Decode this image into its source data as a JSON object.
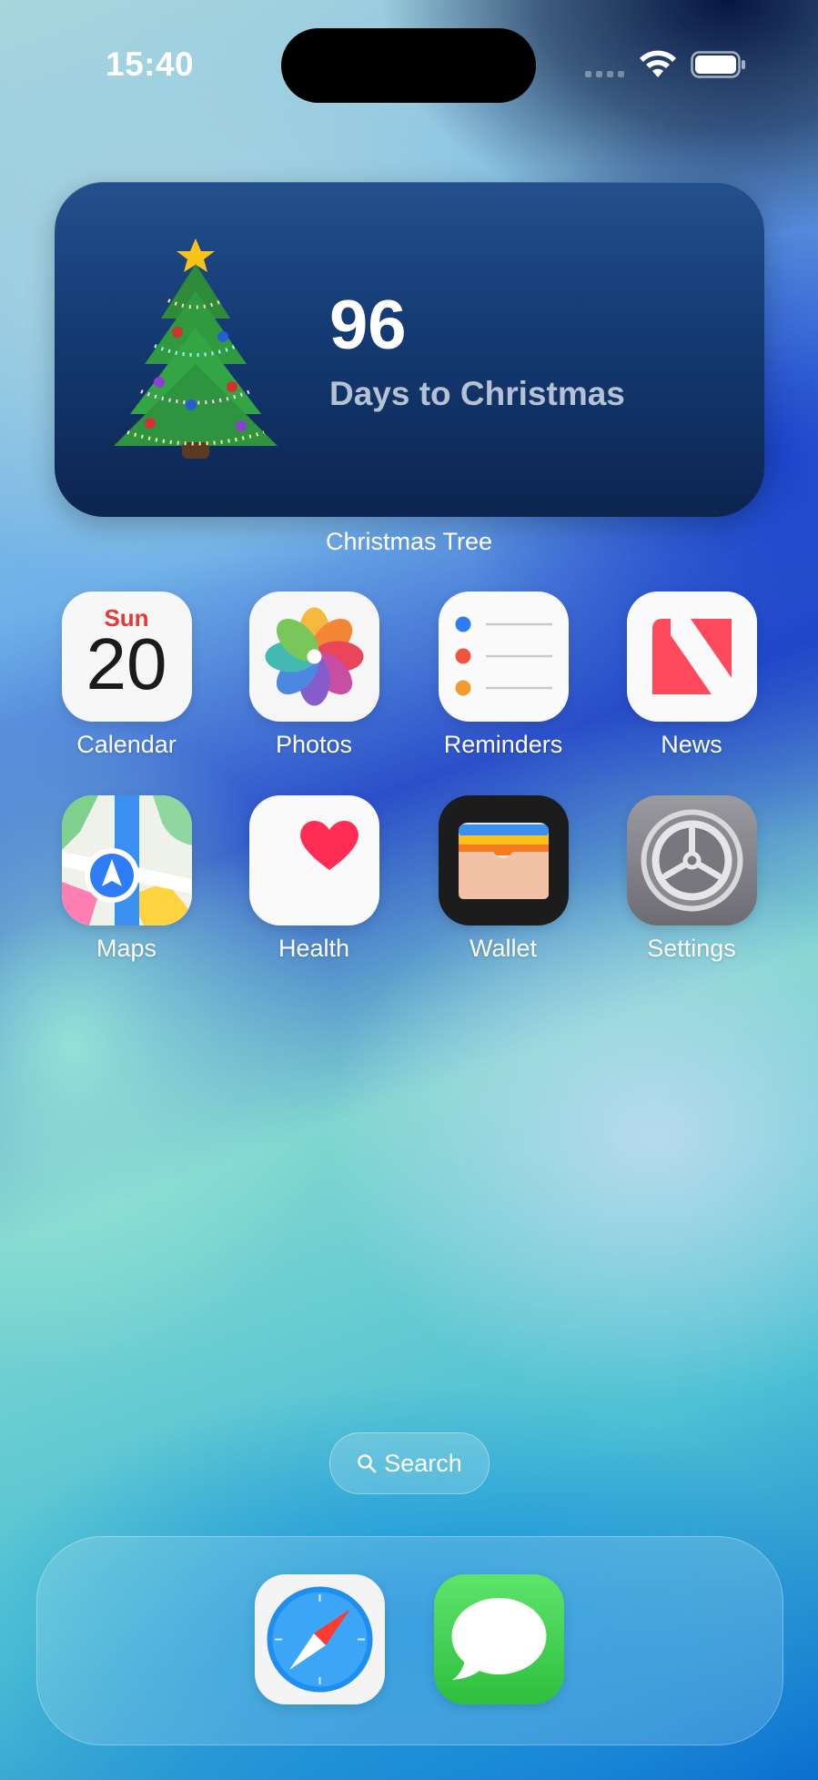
{
  "status_bar": {
    "time": "15:40"
  },
  "widget": {
    "count": "96",
    "label": "Days to Christmas",
    "caption": "Christmas Tree"
  },
  "calendar_icon": {
    "weekday": "Sun",
    "date": "20"
  },
  "apps": [
    {
      "label": "Calendar",
      "icon": "calendar-icon"
    },
    {
      "label": "Photos",
      "icon": "photos-icon"
    },
    {
      "label": "Reminders",
      "icon": "reminders-icon"
    },
    {
      "label": "News",
      "icon": "news-icon"
    },
    {
      "label": "Maps",
      "icon": "maps-icon"
    },
    {
      "label": "Health",
      "icon": "health-icon"
    },
    {
      "label": "Wallet",
      "icon": "wallet-icon"
    },
    {
      "label": "Settings",
      "icon": "settings-icon"
    }
  ],
  "search": {
    "label": "Search"
  },
  "dock": [
    {
      "icon": "safari-icon"
    },
    {
      "icon": "messages-icon"
    }
  ],
  "colors": {
    "widget_bg": "#143a73",
    "calendar_red": "#e53935",
    "news_red": "#ff4a5e",
    "health_red": "#ff2d55",
    "messages_green": "#34c759"
  }
}
